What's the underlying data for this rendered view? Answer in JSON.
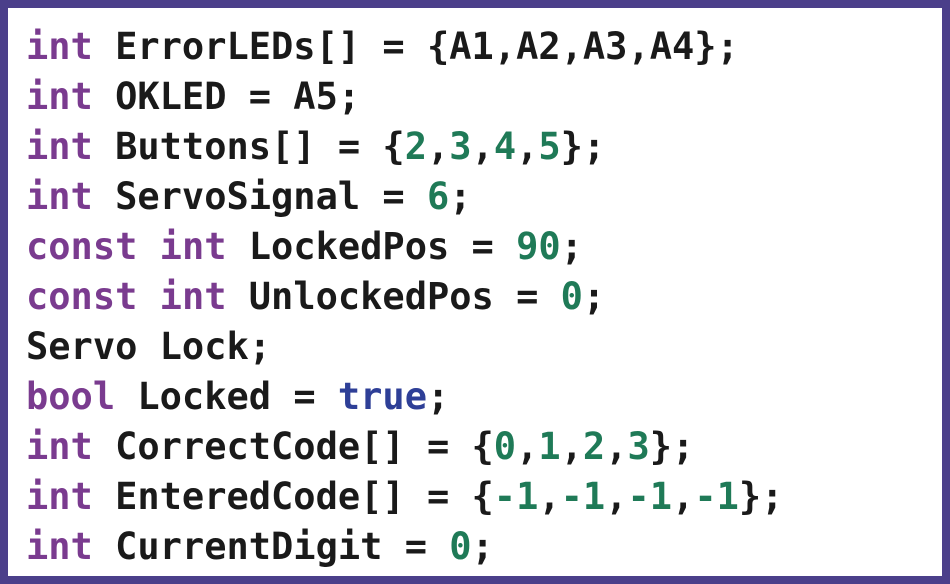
{
  "colors": {
    "border": "#4b3f8a",
    "keyword": "#7a3b8f",
    "number": "#1f7a57",
    "literal": "#2e3f97",
    "text": "#1a1a1a",
    "background": "#ffffff"
  },
  "code_lines": [
    [
      {
        "t": "int",
        "k": "kw"
      },
      {
        "t": " ErrorLEDs[] = {A1,A2,A3,A4};",
        "k": "txt"
      }
    ],
    [
      {
        "t": "int",
        "k": "kw"
      },
      {
        "t": " OKLED = A5;",
        "k": "txt"
      }
    ],
    [
      {
        "t": "int",
        "k": "kw"
      },
      {
        "t": " Buttons[] = {",
        "k": "txt"
      },
      {
        "t": "2",
        "k": "num"
      },
      {
        "t": ",",
        "k": "txt"
      },
      {
        "t": "3",
        "k": "num"
      },
      {
        "t": ",",
        "k": "txt"
      },
      {
        "t": "4",
        "k": "num"
      },
      {
        "t": ",",
        "k": "txt"
      },
      {
        "t": "5",
        "k": "num"
      },
      {
        "t": "};",
        "k": "txt"
      }
    ],
    [
      {
        "t": "int",
        "k": "kw"
      },
      {
        "t": " ServoSignal = ",
        "k": "txt"
      },
      {
        "t": "6",
        "k": "num"
      },
      {
        "t": ";",
        "k": "txt"
      }
    ],
    [
      {
        "t": "const",
        "k": "kw"
      },
      {
        "t": " ",
        "k": "txt"
      },
      {
        "t": "int",
        "k": "kw"
      },
      {
        "t": " LockedPos = ",
        "k": "txt"
      },
      {
        "t": "90",
        "k": "num"
      },
      {
        "t": ";",
        "k": "txt"
      }
    ],
    [
      {
        "t": "const",
        "k": "kw"
      },
      {
        "t": " ",
        "k": "txt"
      },
      {
        "t": "int",
        "k": "kw"
      },
      {
        "t": " UnlockedPos = ",
        "k": "txt"
      },
      {
        "t": "0",
        "k": "num"
      },
      {
        "t": ";",
        "k": "txt"
      }
    ],
    [
      {
        "t": "Servo Lock;",
        "k": "txt"
      }
    ],
    [
      {
        "t": "bool",
        "k": "kw"
      },
      {
        "t": " Locked = ",
        "k": "txt"
      },
      {
        "t": "true",
        "k": "lit"
      },
      {
        "t": ";",
        "k": "txt"
      }
    ],
    [
      {
        "t": "int",
        "k": "kw"
      },
      {
        "t": " CorrectCode[] = {",
        "k": "txt"
      },
      {
        "t": "0",
        "k": "num"
      },
      {
        "t": ",",
        "k": "txt"
      },
      {
        "t": "1",
        "k": "num"
      },
      {
        "t": ",",
        "k": "txt"
      },
      {
        "t": "2",
        "k": "num"
      },
      {
        "t": ",",
        "k": "txt"
      },
      {
        "t": "3",
        "k": "num"
      },
      {
        "t": "};",
        "k": "txt"
      }
    ],
    [
      {
        "t": "int",
        "k": "kw"
      },
      {
        "t": " EnteredCode[] = {",
        "k": "txt"
      },
      {
        "t": "-1",
        "k": "num"
      },
      {
        "t": ",",
        "k": "txt"
      },
      {
        "t": "-1",
        "k": "num"
      },
      {
        "t": ",",
        "k": "txt"
      },
      {
        "t": "-1",
        "k": "num"
      },
      {
        "t": ",",
        "k": "txt"
      },
      {
        "t": "-1",
        "k": "num"
      },
      {
        "t": "};",
        "k": "txt"
      }
    ],
    [
      {
        "t": "int",
        "k": "kw"
      },
      {
        "t": " CurrentDigit = ",
        "k": "txt"
      },
      {
        "t": "0",
        "k": "num"
      },
      {
        "t": ";",
        "k": "txt"
      }
    ]
  ]
}
